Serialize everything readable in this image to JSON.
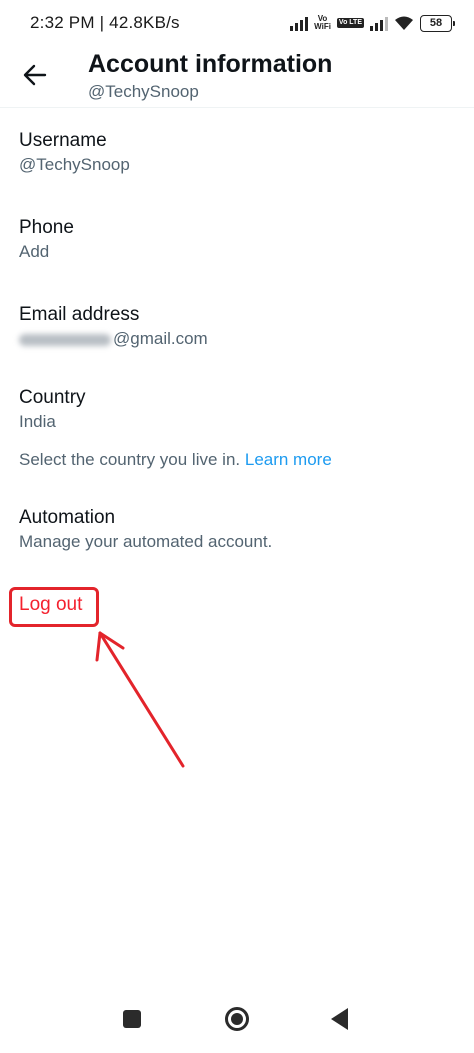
{
  "status_bar": {
    "time_speed": "2:32 PM | 42.8KB/s",
    "vo_wifi_top": "Vo",
    "vo_wifi_bottom": "WiFi",
    "volte": "Vo LTE",
    "battery": "58"
  },
  "header": {
    "title": "Account information",
    "handle": "@TechySnoop"
  },
  "rows": {
    "username": {
      "label": "Username",
      "value": "@TechySnoop"
    },
    "phone": {
      "label": "Phone",
      "value": "Add"
    },
    "email": {
      "label": "Email address",
      "value_suffix": "@gmail.com"
    },
    "country": {
      "label": "Country",
      "value": "India"
    },
    "country_hint": {
      "text": "Select the country you live in.",
      "link": "Learn more"
    },
    "automation": {
      "label": "Automation",
      "value": "Manage your automated account."
    }
  },
  "logout": {
    "label": "Log out"
  },
  "colors": {
    "primary_text": "#0f1419",
    "secondary_text": "#536471",
    "link": "#1d9bf0",
    "danger": "#f4212e",
    "annotation_red": "#e3242b"
  },
  "icons": {
    "back": "arrow-left-icon",
    "nav_recents": "square-icon",
    "nav_home": "circle-home-icon",
    "nav_back": "triangle-back-icon"
  }
}
